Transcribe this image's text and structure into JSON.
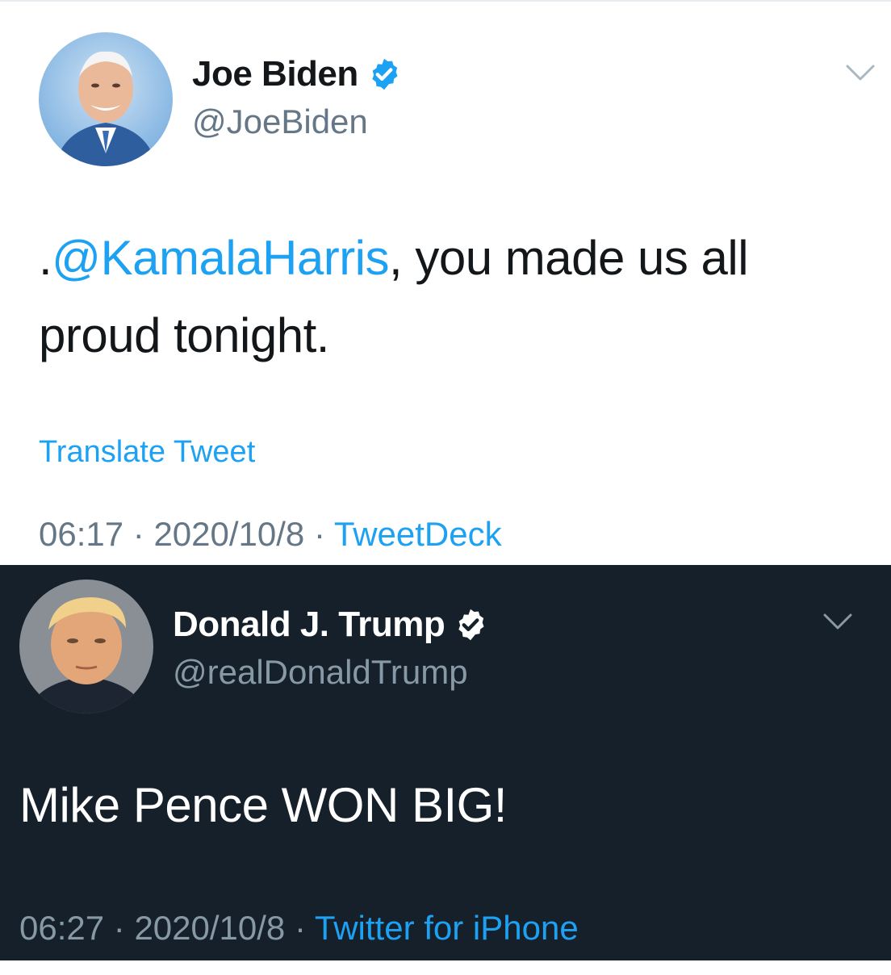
{
  "tweets": [
    {
      "display_name": "Joe Biden",
      "handle": "@JoeBiden",
      "text_prefix": ".",
      "mention": "@KamalaHarris",
      "text_rest": ", you made us all proud tonight.",
      "translate": "Translate Tweet",
      "time": "06:17",
      "separator": " · ",
      "date": "2020/10/8",
      "source": "TweetDeck",
      "verified_color": "#1da1f2",
      "theme": "light"
    },
    {
      "display_name": "Donald J. Trump",
      "handle": "@realDonaldTrump",
      "text": "Mike Pence WON BIG!",
      "time": "06:27",
      "separator": " · ",
      "date": "2020/10/8",
      "source": "Twitter for iPhone",
      "verified_color": "#ffffff",
      "theme": "dark"
    }
  ],
  "icons": {
    "verified": "verified-badge-icon",
    "caret": "chevron-down-icon"
  },
  "colors": {
    "link": "#1da1f2",
    "dark_bg": "#15202b",
    "light_bg": "#ffffff"
  }
}
